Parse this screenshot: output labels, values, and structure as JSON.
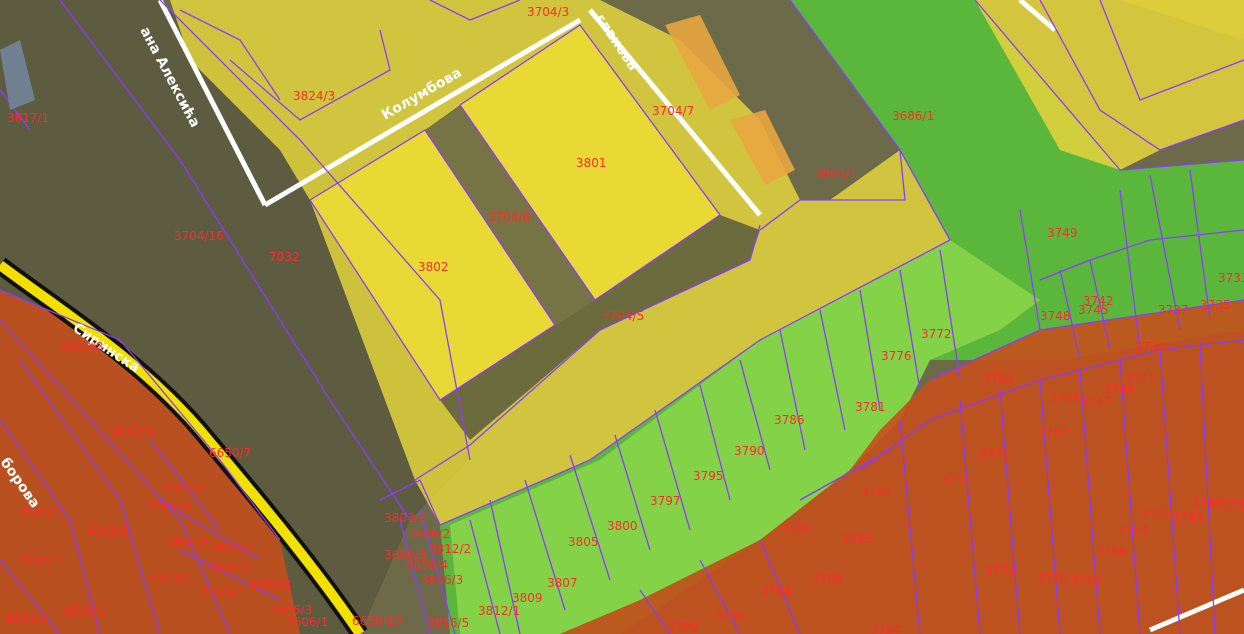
{
  "map": {
    "zones": {
      "yellow": "#e8dc3c",
      "green": "#5ec43a",
      "light_green": "#9ee04a",
      "orange": "#c8521a",
      "boundary": "#8a3cff",
      "label": "#ff2b2b",
      "road": "#ffffff",
      "highway": "#f2e100"
    },
    "streets": [
      "Колумбова",
      "ана Алексића",
      "гланова",
      "Сиринска",
      "борова"
    ],
    "parcels": [
      "3704/3",
      "3824/3",
      "3817/1",
      "3686/1",
      "3704/7",
      "3801",
      "3803/1",
      "3704/6",
      "3704/16",
      "7032",
      "3802",
      "3749",
      "3704/5",
      "3742",
      "3745",
      "3733",
      "3737",
      "3735",
      "3748",
      "3772",
      "3739",
      "3776",
      "3769",
      "3741",
      "3744",
      "3765",
      "3747",
      "3781",
      "3786",
      "3767",
      "3771",
      "3775",
      "3790",
      "3795",
      "3783",
      "3797",
      "3800",
      "3789",
      "3785",
      "3805",
      "3807",
      "3809",
      "3812/1",
      "3796",
      "3794",
      "3788",
      "3799",
      "3784",
      "3774",
      "3770",
      "3768",
      "3766",
      "3764",
      "3746",
      "3743",
      "3740",
      "3738",
      "6650/8",
      "4601/4",
      "6650/7",
      "4601/2",
      "4601/3",
      "4598/7",
      "4602/1",
      "4602/4",
      "4602/2",
      "4598/5",
      "4603/1",
      "4603/3",
      "4603/2",
      "4603/4",
      "4593/3",
      "4598/1",
      "4606/3",
      "4606/1",
      "6650/19",
      "3803/2",
      "3686/2",
      "3812/2",
      "3686/3",
      "6650/4",
      "3816/3",
      "3816/5"
    ]
  }
}
